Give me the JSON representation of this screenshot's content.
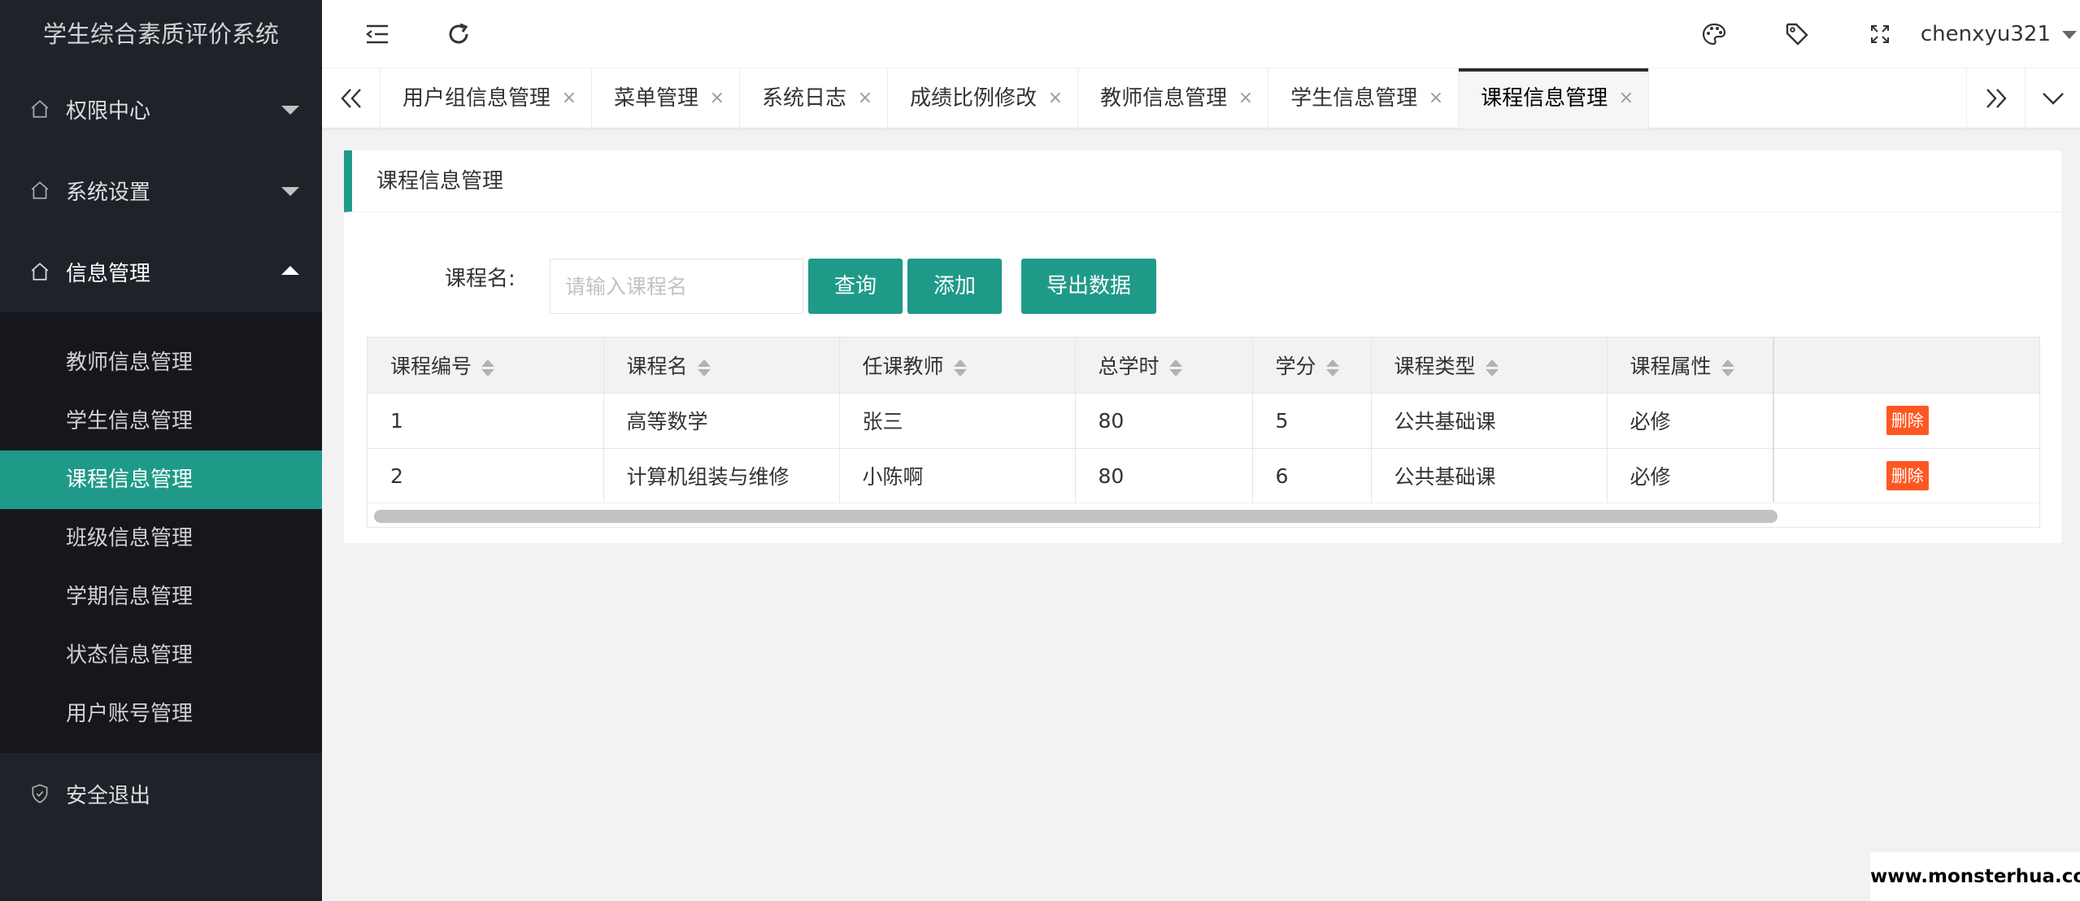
{
  "app": {
    "title": "学生综合素质评价系统"
  },
  "sidebar": {
    "groups": [
      {
        "label": "权限中心"
      },
      {
        "label": "系统设置"
      },
      {
        "label": "信息管理"
      },
      {
        "label": "安全退出"
      }
    ],
    "info_items": [
      {
        "label": "教师信息管理"
      },
      {
        "label": "学生信息管理"
      },
      {
        "label": "课程信息管理"
      },
      {
        "label": "班级信息管理"
      },
      {
        "label": "学期信息管理"
      },
      {
        "label": "状态信息管理"
      },
      {
        "label": "用户账号管理"
      }
    ],
    "active_item": "课程信息管理"
  },
  "header": {
    "username": "chenxyu321",
    "icons": [
      "menu-fold-icon",
      "refresh-icon",
      "palette-icon",
      "tag-icon",
      "fullscreen-icon"
    ]
  },
  "tabs": {
    "items": [
      {
        "label": "用户组信息管理"
      },
      {
        "label": "菜单管理"
      },
      {
        "label": "系统日志"
      },
      {
        "label": "成绩比例修改"
      },
      {
        "label": "教师信息管理"
      },
      {
        "label": "学生信息管理"
      },
      {
        "label": "课程信息管理"
      }
    ],
    "close_glyph": "×",
    "active": "课程信息管理"
  },
  "card": {
    "title": "课程信息管理",
    "search_label": "课程名:",
    "search_placeholder": "请输入课程名",
    "buttons": {
      "query": "查询",
      "add": "添加",
      "export": "导出数据"
    }
  },
  "table": {
    "columns": [
      "课程编号",
      "课程名",
      "任课教师",
      "总学时",
      "学分",
      "课程类型",
      "课程属性"
    ],
    "rows": [
      [
        "1",
        "高等数学",
        "张三",
        "80",
        "5",
        "公共基础课",
        "必修"
      ],
      [
        "2",
        "计算机组装与维修",
        "小陈啊",
        "80",
        "6",
        "公共基础课",
        "必修"
      ]
    ],
    "action_label": "删除"
  },
  "watermark": "www.monsterhua.com",
  "colors": {
    "accent": "#1f9a89",
    "sidebar_bg": "#20222a",
    "danger": "#ff5722"
  }
}
